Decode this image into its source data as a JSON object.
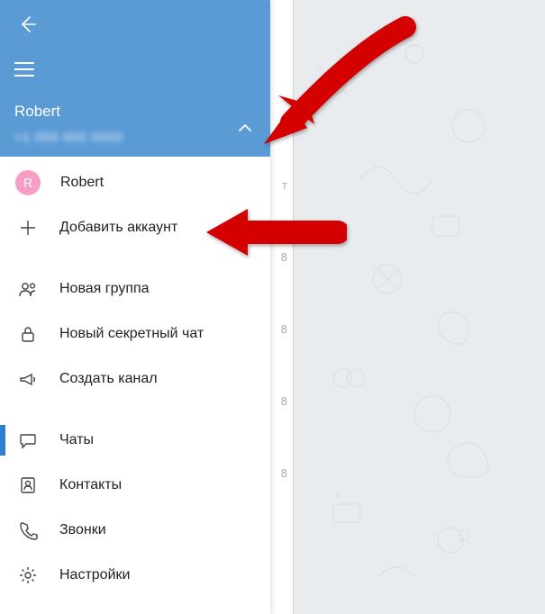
{
  "header": {
    "account_name": "Robert",
    "account_phone": "+1 000 000 0000"
  },
  "accounts": {
    "current": {
      "initial": "R",
      "name": "Robert"
    },
    "add_label": "Добавить аккаунт"
  },
  "menu": {
    "new_group": "Новая группа",
    "secret_chat": "Новый секретный чат",
    "new_channel": "Создать канал",
    "chats": "Чаты",
    "contacts": "Контакты",
    "calls": "Звонки",
    "settings": "Настройки"
  },
  "strip": {
    "t1": "т",
    "n1": "8",
    "n2": "8",
    "n3": "8",
    "n4": "8"
  },
  "colors": {
    "header_bg": "#5b9bd5",
    "accent": "#2f7fd1",
    "arrow": "#e3000f"
  }
}
